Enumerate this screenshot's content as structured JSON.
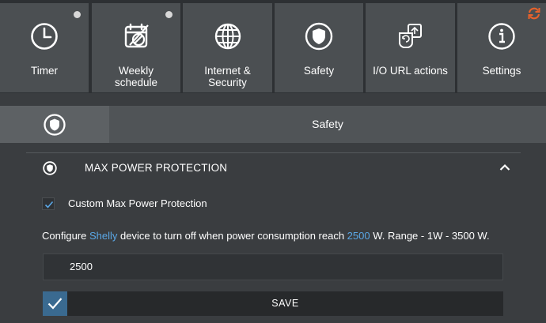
{
  "tiles": [
    {
      "label": "Timer",
      "icon": "clock-icon",
      "indicator": true
    },
    {
      "label": "Weekly\nschedule",
      "icon": "calendar-off-icon",
      "indicator": true
    },
    {
      "label": "Internet &\nSecurity",
      "icon": "globe-icon",
      "indicator": false
    },
    {
      "label": "Safety",
      "icon": "shield-icon",
      "indicator": false
    },
    {
      "label": "I/O URL actions",
      "icon": "io-actions-icon",
      "indicator": false
    },
    {
      "label": "Settings",
      "icon": "info-icon",
      "indicator": false
    }
  ],
  "refresh_icon": "refresh-icon",
  "safety_header": {
    "title": "Safety",
    "icon": "shield-icon"
  },
  "section": {
    "title": "MAX POWER PROTECTION",
    "icon": "shield-icon",
    "toggle_icon": "chevron-up-icon",
    "checkbox": {
      "label": "Custom Max Power Protection",
      "checked": true
    },
    "description": {
      "part1": "Configure ",
      "device": "Shelly",
      "part2": " device to turn off when power consumption reach ",
      "value": "2500",
      "part3": " W. Range - 1W - 3500 W."
    },
    "input_value": "2500",
    "save_label": "SAVE"
  },
  "colors": {
    "accent": "#5aa7e6",
    "save_check_bg": "#3a6a90",
    "refresh": "#e8622b"
  }
}
